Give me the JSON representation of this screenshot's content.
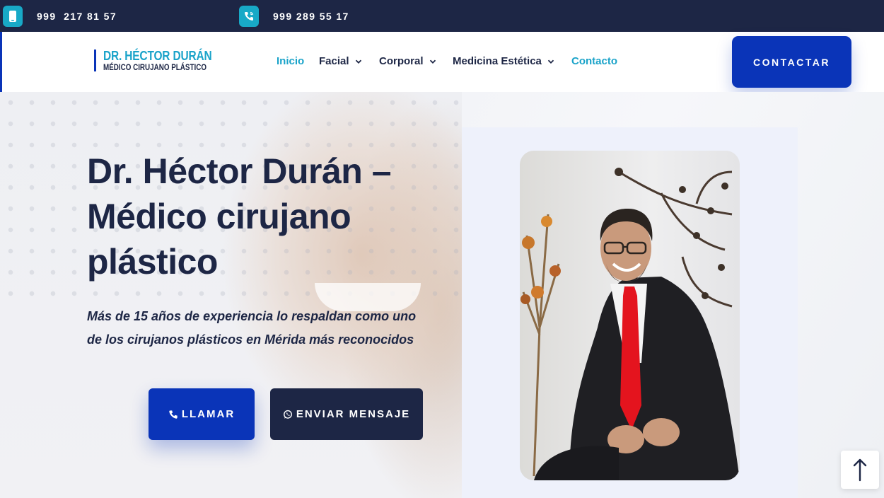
{
  "topbar": {
    "phone1": "999  217 81 57",
    "phone2": "999 289 55 17",
    "icon1": "mobile-phone-icon",
    "icon2": "phone-call-icon"
  },
  "header": {
    "logo_title": "DR. HÉCTOR DURÁN",
    "logo_subtitle": "MÉDICO CIRUJANO PLÁSTICO",
    "nav": [
      {
        "label": "Inicio",
        "active": true,
        "dropdown": false
      },
      {
        "label": "Facial",
        "active": false,
        "dropdown": true
      },
      {
        "label": "Corporal",
        "active": false,
        "dropdown": true
      },
      {
        "label": "Medicina Estética",
        "active": false,
        "dropdown": true
      },
      {
        "label": "Contacto",
        "active": true,
        "dropdown": false
      }
    ],
    "cta_label": "CONTACTAR"
  },
  "hero": {
    "title": "Dr. Héctor Durán – Médico cirujano plástico",
    "subtitle": "Más de 15 años de experiencia lo respaldan como uno de los cirujanos plásticos en Mérida más reconocidos",
    "call_label": "LLAMAR",
    "message_label": "ENVIAR MENSAJE",
    "call_icon": "phone-icon",
    "message_icon": "whatsapp-icon"
  },
  "colors": {
    "navy": "#1d2645",
    "brand_blue": "#0a34b8",
    "cyan": "#1aa3c9"
  }
}
